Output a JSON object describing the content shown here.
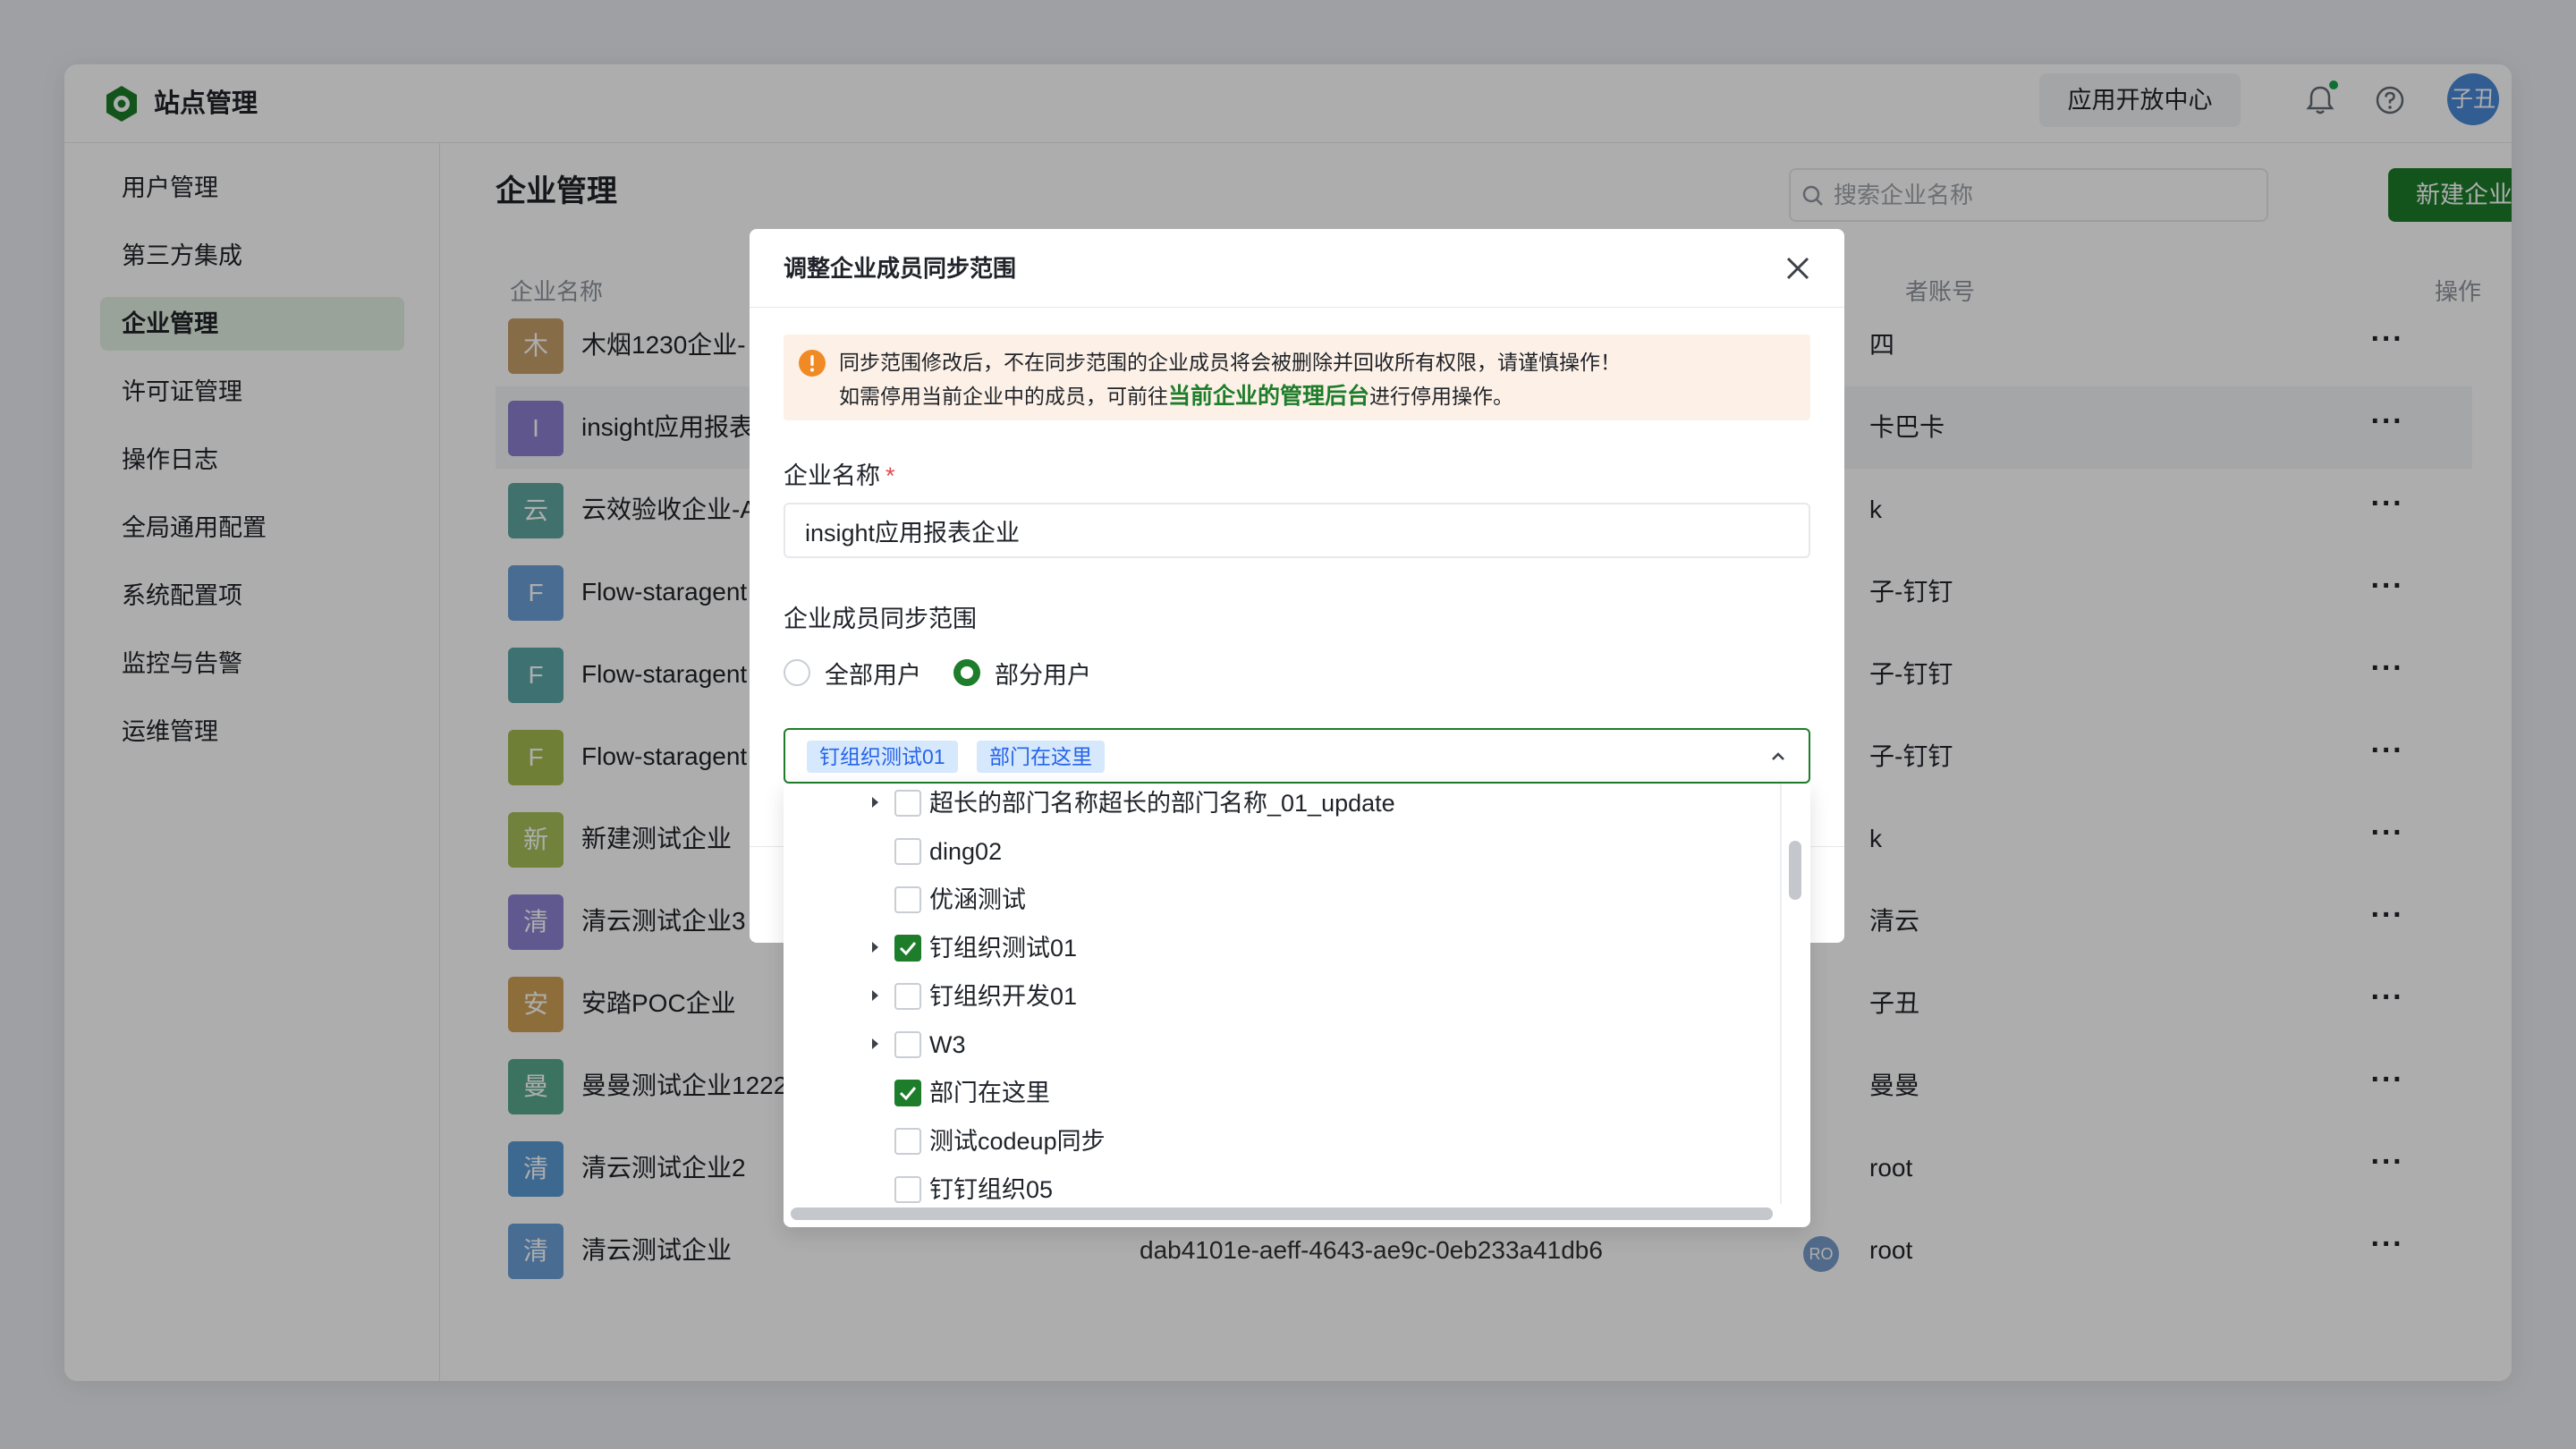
{
  "app": {
    "title": "站点管理",
    "open_center": "应用开放中心",
    "user_avatar": "子丑"
  },
  "sidebar": {
    "items": [
      {
        "label": "用户管理"
      },
      {
        "label": "第三方集成"
      },
      {
        "label": "企业管理",
        "active": true
      },
      {
        "label": "许可证管理"
      },
      {
        "label": "操作日志"
      },
      {
        "label": "全局通用配置"
      },
      {
        "label": "系统配置项"
      },
      {
        "label": "监控与告警"
      },
      {
        "label": "运维管理"
      }
    ]
  },
  "main": {
    "title": "企业管理",
    "search_placeholder": "搜索企业名称",
    "new_button": "新建企业",
    "columns": {
      "name": "企业名称",
      "owner": "者账号",
      "actions": "操作"
    },
    "rows": [
      {
        "badge": "木",
        "badge_color": "#c7a06a",
        "name": "木烟1230企业-",
        "owner": "四",
        "more": "···"
      },
      {
        "badge": "I",
        "badge_color": "#8c7fd0",
        "name": "insight应用报表",
        "owner": "卡巴卡",
        "more": "···"
      },
      {
        "badge": "云",
        "badge_color": "#5fa7a0",
        "name": "云效验收企业-A",
        "owner": "k",
        "more": "···"
      },
      {
        "badge": "F",
        "badge_color": "#6aa0d8",
        "name": "Flow-staragent",
        "owner": "子-钉钉",
        "more": "···"
      },
      {
        "badge": "F",
        "badge_color": "#5aa7a8",
        "name": "Flow-staragent",
        "owner": "子-钉钉",
        "more": "···"
      },
      {
        "badge": "F",
        "badge_color": "#a4bc4f",
        "name": "Flow-staragent",
        "owner": "子-钉钉",
        "more": "···"
      },
      {
        "badge": "新",
        "badge_color": "#a6c058",
        "name": "新建测试企业",
        "owner": "k",
        "more": "···"
      },
      {
        "badge": "清",
        "badge_color": "#8e84d4",
        "name": "清云测试企业3",
        "owner": "清云",
        "more": "···"
      },
      {
        "badge": "安",
        "badge_color": "#d0a256",
        "name": "安踏POC企业",
        "owner": "子丑",
        "more": "···"
      },
      {
        "badge": "曼",
        "badge_color": "#59a88e",
        "name": "曼曼测试企业1222",
        "owner": "曼曼",
        "more": "···"
      },
      {
        "badge": "清",
        "badge_color": "#5a9bd6",
        "name": "清云测试企业2",
        "owner": "root",
        "more": "···"
      },
      {
        "badge": "清",
        "badge_color": "#6aa0d8",
        "name": "清云测试企业",
        "id": "dab4101e-aeff-4643-ae9c-0eb233a41db6",
        "owner_avatar": "RO",
        "owner": "root",
        "more": "···"
      }
    ]
  },
  "modal": {
    "title": "调整企业成员同步范围",
    "alert_line1": "同步范围修改后，不在同步范围的企业成员将会被删除并回收所有权限，请谨慎操作！",
    "alert_line2_pre": "如需停用当前企业中的成员，可前往",
    "alert_link": "当前企业的管理后台",
    "alert_line2_post": "进行停用操作。",
    "name_label": "企业名称",
    "name_required": "*",
    "name_value": "insight应用报表企业",
    "scope_label": "企业成员同步范围",
    "scope_options": [
      {
        "label": "全部用户",
        "selected": false
      },
      {
        "label": "部分用户",
        "selected": true
      }
    ],
    "selected_tags": [
      "钉组织测试01",
      "部门在这里"
    ],
    "tree": [
      {
        "label": "超长的部门名称超长的部门名称_01_update",
        "expandable": true,
        "checked": false
      },
      {
        "label": "ding02",
        "expandable": false,
        "checked": false
      },
      {
        "label": "优涵测试",
        "expandable": false,
        "checked": false
      },
      {
        "label": "钉组织测试01",
        "expandable": true,
        "checked": true
      },
      {
        "label": "钉组织开发01",
        "expandable": true,
        "checked": false
      },
      {
        "label": "W3",
        "expandable": true,
        "checked": false
      },
      {
        "label": "部门在这里",
        "expandable": false,
        "checked": true
      },
      {
        "label": "测试codeup同步",
        "expandable": false,
        "checked": false
      },
      {
        "label": "钉钉组织05",
        "expandable": false,
        "checked": false
      }
    ]
  }
}
